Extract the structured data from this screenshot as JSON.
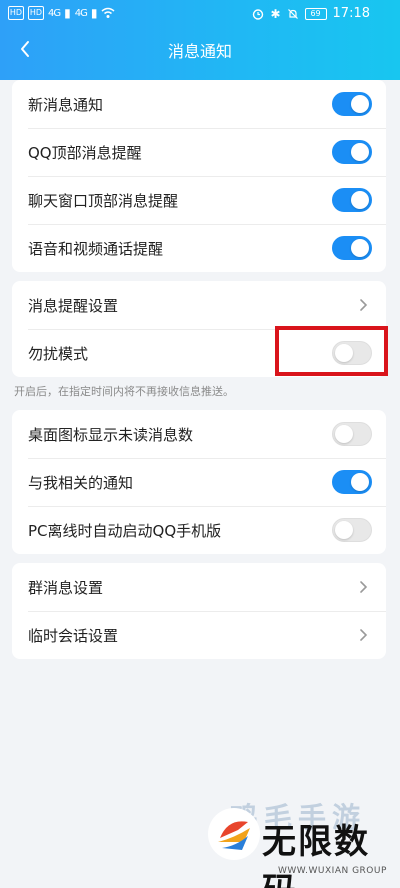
{
  "status_bar": {
    "sim1": "HD",
    "sim2": "HD",
    "signal1": "4G",
    "signal2": "4G",
    "battery": "69",
    "time": "17:18"
  },
  "nav": {
    "title": "消息通知"
  },
  "group1": [
    {
      "label": "新消息通知",
      "on": true
    },
    {
      "label": "QQ顶部消息提醒",
      "on": true
    },
    {
      "label": "聊天窗口顶部消息提醒",
      "on": true
    },
    {
      "label": "语音和视频通话提醒",
      "on": true
    }
  ],
  "group2": {
    "reminder_settings": "消息提醒设置",
    "dnd_label": "勿扰模式",
    "dnd_on": false
  },
  "hint": "开启后，在指定时间内将不再接收信息推送。",
  "group3": [
    {
      "label": "桌面图标显示未读消息数",
      "on": false
    },
    {
      "label": "与我相关的通知",
      "on": true
    },
    {
      "label": "PC离线时自动启动QQ手机版",
      "on": false
    }
  ],
  "group4": {
    "group_msg_settings": "群消息设置",
    "temp_chat_settings": "临时会话设置"
  },
  "watermark": {
    "faded_text": "鸡毛手游",
    "brand": "无限数码",
    "url": "WWW.WUXIAN GROUP"
  },
  "colors": {
    "accent": "#1b8ef5",
    "header": "#2ea0f8",
    "highlight": "#d9141b"
  }
}
